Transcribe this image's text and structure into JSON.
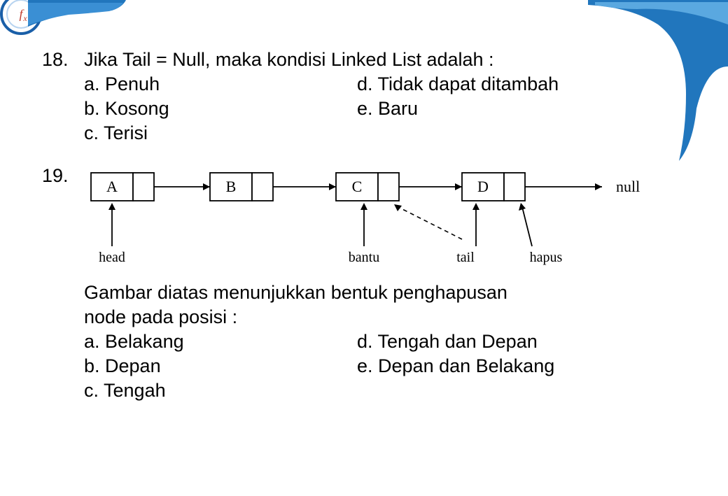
{
  "q18": {
    "number": "18.",
    "text": "Jika Tail = Null, maka kondisi Linked List adalah :",
    "options": {
      "a": "a. Penuh",
      "b": "b. Kosong",
      "c": "c. Terisi",
      "d": "d. Tidak dapat ditambah",
      "e": "e. Baru"
    }
  },
  "q19": {
    "number": "19.",
    "diagram": {
      "nodes": [
        "A",
        "B",
        "C",
        "D"
      ],
      "end_label": "null",
      "labels": {
        "head": "head",
        "bantu": "bantu",
        "tail": "tail",
        "hapus": "hapus"
      }
    },
    "text_line1": "Gambar diatas menunjukkan bentuk penghapusan",
    "text_line2": "node pada posisi :",
    "options": {
      "a": "a. Belakang",
      "b": "b. Depan",
      "c": "c. Tengah",
      "d": "d. Tengah dan Depan",
      "e": "e. Depan dan Belakang"
    }
  }
}
